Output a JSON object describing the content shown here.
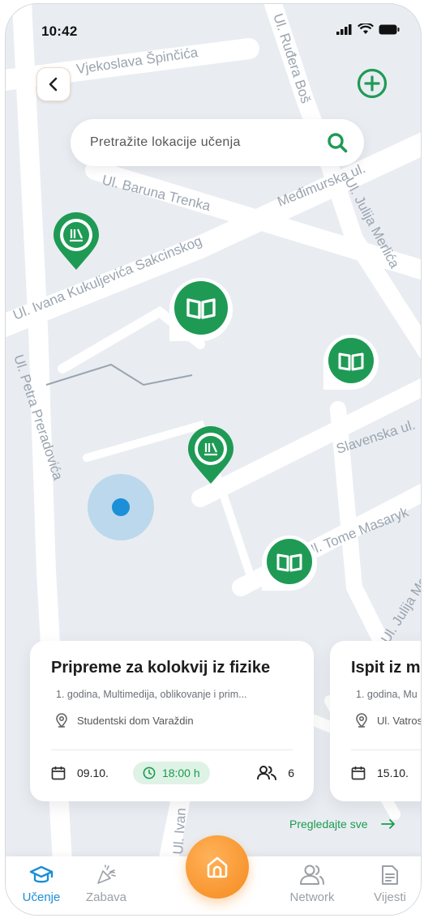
{
  "status_bar": {
    "time": "10:42"
  },
  "map": {
    "streets": [
      "Vjekoslava Špinčića",
      "Ul. Ruđera Boš",
      "Ul. Baruna Trenka",
      "Međimurska ul.",
      "Ul. Julija Merlića",
      "Ul. Ivana Kukuljevića Sakcinskog",
      "Ul. Petra Preradovića",
      "Slavenska ul.",
      "Ul. Tome Masaryk",
      "Ul. Julija Merlić",
      "Ul. Ivan"
    ]
  },
  "search": {
    "placeholder": "Pretražite lokacije učenja"
  },
  "cards": [
    {
      "title": "Pripreme za kolokvij iz fizike",
      "subtitle": "1. godina, Multimedija, oblikovanje i prim...",
      "location": "Studentski dom Varaždin",
      "date": "09.10.",
      "time": "18:00 h",
      "participants": "6"
    },
    {
      "title": "Ispit iz m",
      "subtitle": "1. godina, Mu",
      "location": "Ul. Vatros",
      "date": "15.10."
    }
  ],
  "see_all_label": "Pregledajte sve",
  "bottom_nav": {
    "ucenje": "Učenje",
    "zabava": "Zabava",
    "network": "Network",
    "vijesti": "Vijesti"
  },
  "colors": {
    "accent_green": "#1f9a55",
    "accent_blue": "#1b8fd8",
    "accent_orange": "#f58a1e"
  }
}
